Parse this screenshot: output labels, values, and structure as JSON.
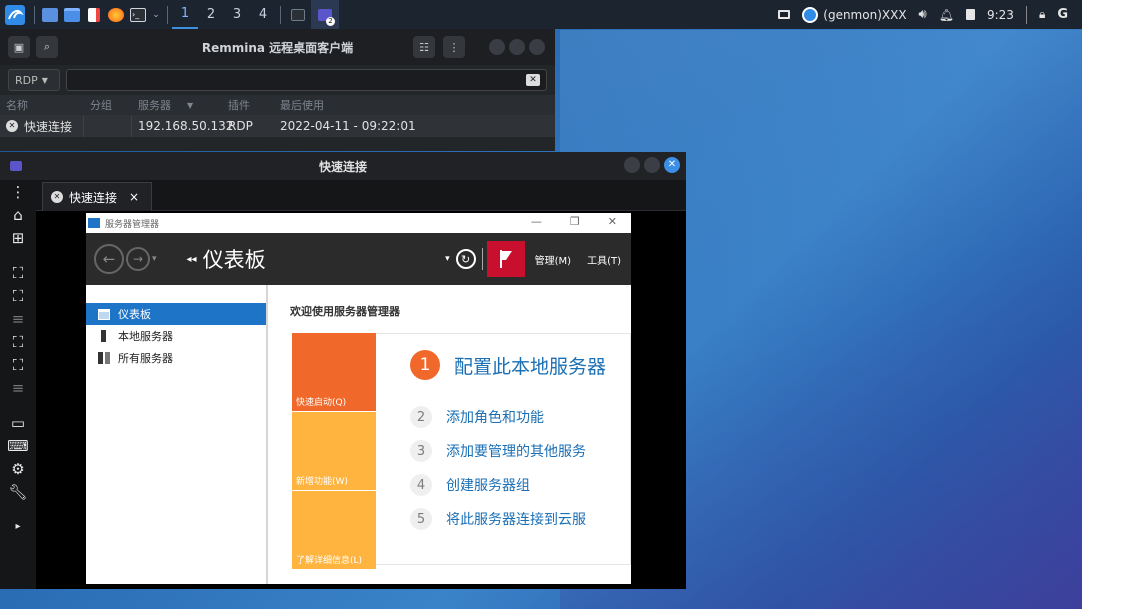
{
  "panel": {
    "workspaces": [
      "1",
      "2",
      "3",
      "4"
    ],
    "genmon": "(genmon)XXX",
    "clock": "9:23",
    "badge": "2"
  },
  "remmina": {
    "title": "Remmina 远程桌面客户端",
    "protocol": "RDP",
    "search_value": "",
    "columns": [
      "名称",
      "分组",
      "服务器",
      "插件",
      "最后使用"
    ],
    "rows": [
      {
        "name": "快速连接",
        "group": "",
        "server": "192.168.50.132",
        "plugin": "RDP",
        "last_used": "2022-04-11 - 09:22:01"
      }
    ]
  },
  "quick_connect": {
    "title": "快速连接",
    "tab_label": "快速连接",
    "tab_close": "×"
  },
  "server_manager": {
    "window_title": "服务器管理器",
    "breadcrumb": "仪表板",
    "menu": [
      "管理(M)",
      "工具(T)"
    ],
    "sidebar": [
      {
        "label": "仪表板",
        "selected": true
      },
      {
        "label": "本地服务器",
        "selected": false
      },
      {
        "label": "所有服务器",
        "selected": false
      }
    ],
    "welcome": "欢迎使用服务器管理器",
    "tiles": [
      {
        "label": "快速启动(Q)",
        "color": "#f0682a"
      },
      {
        "label": "新增功能(W)",
        "color": "#ffb43f"
      },
      {
        "label": "了解详细信息(L)",
        "color": "#ffb43f"
      }
    ],
    "steps": [
      {
        "num": "1",
        "label": "配置此本地服务器"
      },
      {
        "num": "2",
        "label": "添加角色和功能"
      },
      {
        "num": "3",
        "label": "添加要管理的其他服务"
      },
      {
        "num": "4",
        "label": "创建服务器组"
      },
      {
        "num": "5",
        "label": "将此服务器连接到云服"
      }
    ]
  },
  "colors": {
    "accent": "#3c8fe6",
    "sm_selected": "#1e75c8",
    "orange": "#f0682a",
    "amber": "#ffb43f",
    "flag_red": "#c8102e"
  }
}
